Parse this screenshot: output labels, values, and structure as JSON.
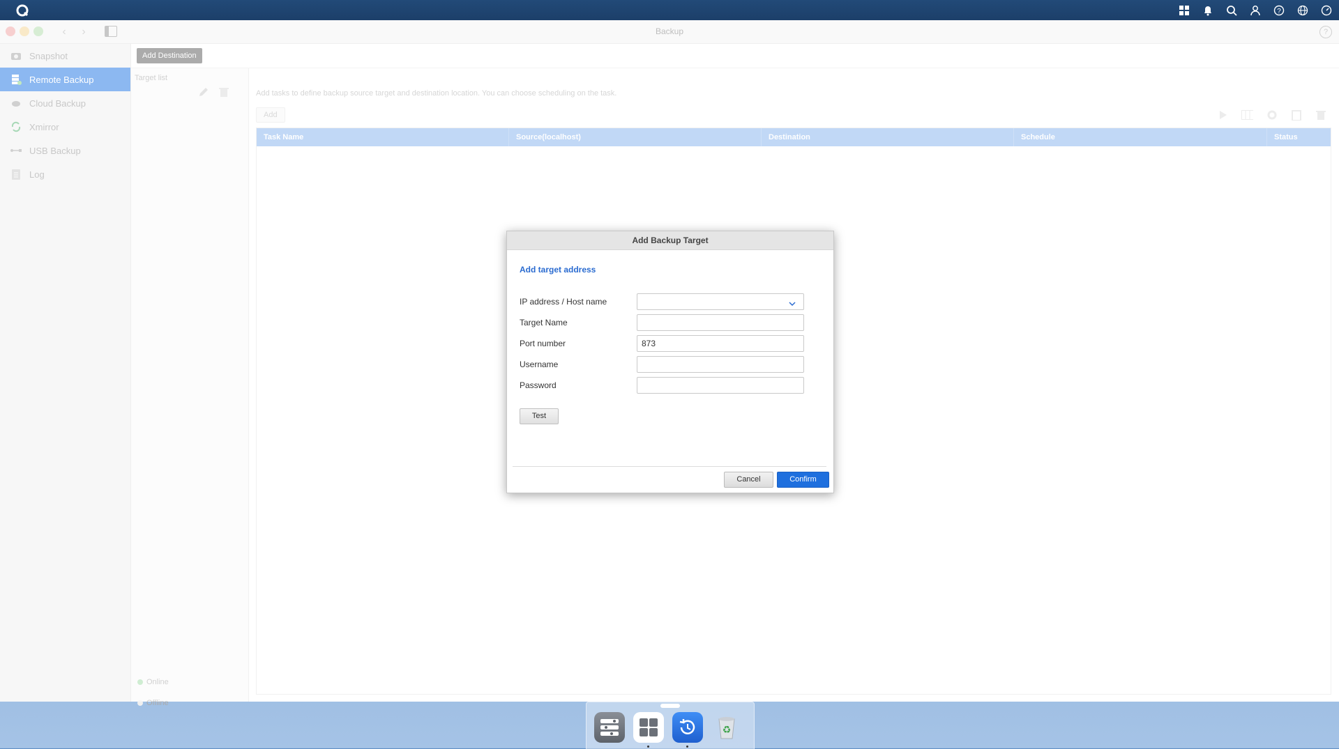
{
  "window": {
    "title": "Backup"
  },
  "sidebar": {
    "items": [
      {
        "label": "Snapshot",
        "icon": "camera-icon"
      },
      {
        "label": "Remote Backup",
        "icon": "server-icon"
      },
      {
        "label": "Cloud Backup",
        "icon": "cloud-icon"
      },
      {
        "label": "Xmirror",
        "icon": "sync-icon"
      },
      {
        "label": "USB Backup",
        "icon": "usb-icon"
      },
      {
        "label": "Log",
        "icon": "log-icon"
      }
    ],
    "active_index": 1
  },
  "toolbar": {
    "add_destination": "Add Destination"
  },
  "target_list": {
    "label": "Target list",
    "legend_online": "Online",
    "legend_offline": "Offline"
  },
  "content": {
    "hint": "Add tasks to define backup source target and destination location. You can choose scheduling on the task.",
    "add_button": "Add",
    "columns": [
      "Task Name",
      "Source(localhost)",
      "Destination",
      "Schedule",
      "Status"
    ]
  },
  "modal": {
    "title": "Add Backup Target",
    "subtitle": "Add target address",
    "fields": [
      {
        "label": "IP address / Host name",
        "value": "",
        "type": "combo"
      },
      {
        "label": "Target Name",
        "value": ""
      },
      {
        "label": "Port number",
        "value": "873"
      },
      {
        "label": "Username",
        "value": ""
      },
      {
        "label": "Password",
        "value": ""
      }
    ],
    "test_button": "Test",
    "cancel_button": "Cancel",
    "confirm_button": "Confirm"
  },
  "colors": {
    "accent": "#2f7fe5",
    "table_header": "#8fb8ee",
    "confirm": "#1e6fde",
    "online": "#34c759"
  }
}
